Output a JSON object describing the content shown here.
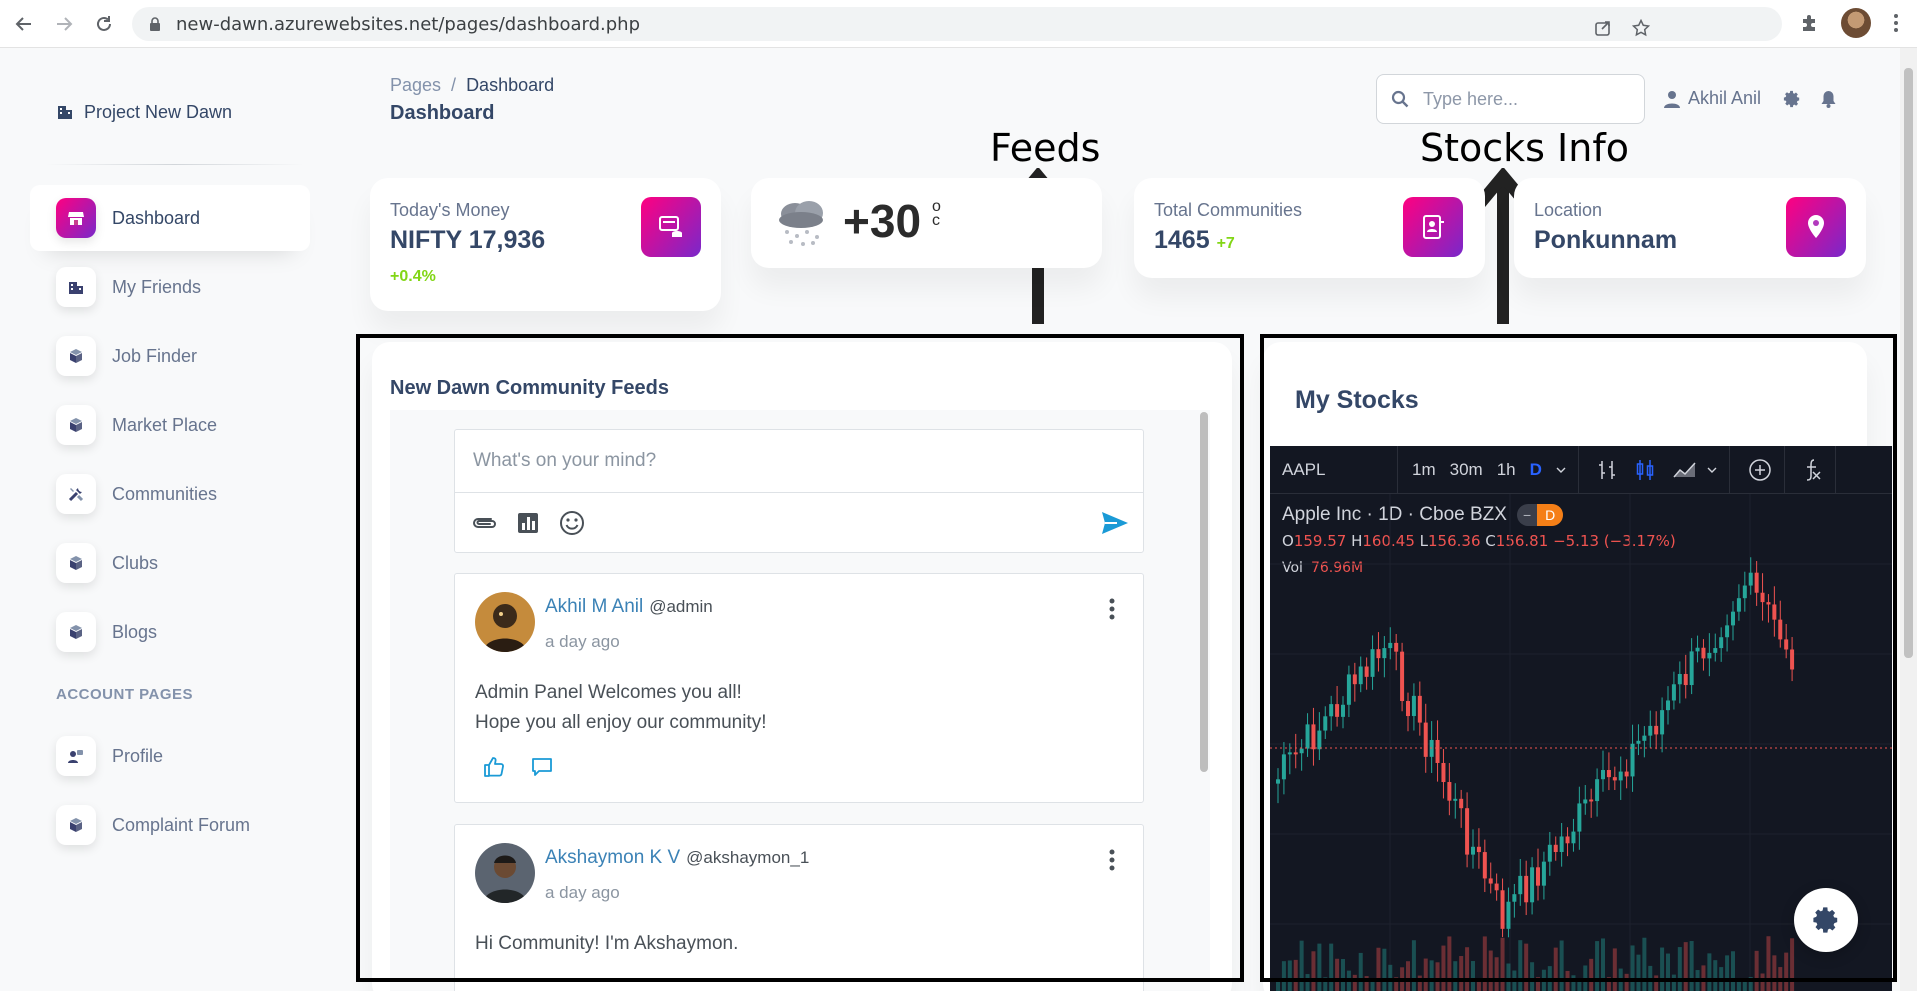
{
  "browser": {
    "url": "new-dawn.azurewebsites.net/pages/dashboard.php"
  },
  "sidebar": {
    "brand": "Project New Dawn",
    "items": [
      {
        "label": "Dashboard",
        "icon": "shop-icon",
        "active": true
      },
      {
        "label": "My Friends",
        "icon": "office-icon"
      },
      {
        "label": "Job Finder",
        "icon": "box-3d-icon"
      },
      {
        "label": "Market Place",
        "icon": "box-3d-icon"
      },
      {
        "label": "Communities",
        "icon": "settings-tools-icon"
      },
      {
        "label": "Clubs",
        "icon": "box-3d-icon"
      },
      {
        "label": "Blogs",
        "icon": "box-3d-icon"
      }
    ],
    "section_label": "ACCOUNT PAGES",
    "account_items": [
      {
        "label": "Profile",
        "icon": "customer-support-icon"
      },
      {
        "label": "Complaint Forum",
        "icon": "box-3d-icon"
      }
    ]
  },
  "header": {
    "breadcrumb_root": "Pages",
    "breadcrumb_sep": "/",
    "breadcrumb_current": "Dashboard",
    "title": "Dashboard",
    "search_placeholder": "Type here...",
    "user_name": "Akhil Anil"
  },
  "stats": {
    "money": {
      "label": "Today's Money",
      "value": "NIFTY 17,936",
      "delta": "+0.4%"
    },
    "weather": {
      "temp": "+30",
      "unit_deg": "o",
      "unit_c": "c"
    },
    "communities": {
      "label": "Total Communities",
      "value": "1465",
      "delta": "+7"
    },
    "location": {
      "label": "Location",
      "value": "Ponkunnam"
    }
  },
  "annotations": {
    "feeds": "Feeds",
    "stocks": "Stocks Info"
  },
  "feeds": {
    "title": "New Dawn Community Feeds",
    "composer_placeholder": "What's on your mind?",
    "posts": [
      {
        "name": "Akhil M Anil",
        "handle": "@admin",
        "time": "a day ago",
        "line1": "Admin Panel Welcomes you all!",
        "line2": "Hope you all enjoy our community!"
      },
      {
        "name": "Akshaymon K V",
        "handle": "@akshaymon_1",
        "time": "a day ago",
        "line1": "Hi Community! I'm Akshaymon.",
        "line2": ""
      }
    ]
  },
  "stocks": {
    "title": "My Stocks",
    "symbol": "AAPL",
    "intervals": [
      "1m",
      "30m",
      "1h",
      "D"
    ],
    "active_interval": "D",
    "instrument": "Apple Inc · 1D · Cboe BZX",
    "badge_left": "−",
    "badge_right": "D",
    "ohlc": {
      "o_label": "O",
      "o": "159.57",
      "h_label": "H",
      "h": "160.45",
      "l_label": "L",
      "l": "156.36",
      "c_label": "C",
      "c": "156.81",
      "chg": "−5.13 (−3.17%)"
    },
    "vol_label": "Vol",
    "vol": "76.96M",
    "colors": {
      "up": "#26a69a",
      "down": "#ef5350",
      "bg": "#131722"
    }
  }
}
